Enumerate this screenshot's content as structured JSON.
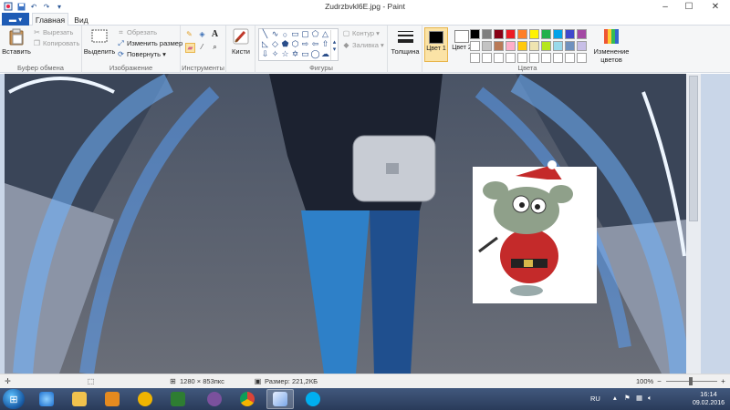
{
  "window": {
    "title": "Zudrzbvkl6E.jpg - Paint",
    "controls": {
      "minimize": "–",
      "maximize": "☐",
      "close": "✕"
    }
  },
  "tabs": {
    "file_label": "▬ ▾",
    "home": "Главная",
    "view": "Вид"
  },
  "ribbon": {
    "clipboard": {
      "paste": "Вставить",
      "cut": "Вырезать",
      "copy": "Копировать",
      "label": "Буфер обмена"
    },
    "image": {
      "select": "Выделить",
      "crop": "Обрезать",
      "resize": "Изменить размер",
      "rotate": "Повернуть ▾",
      "label": "Изображение"
    },
    "tools": {
      "label": "Инструменты"
    },
    "brushes": {
      "label": "Кисти"
    },
    "shapes": {
      "outline": "Контур ▾",
      "fill": "Заливка ▾",
      "label": "Фигуры"
    },
    "thickness": {
      "label": "Толщина"
    },
    "colors": {
      "color1": "Цвет 1",
      "color2": "Цвет 2",
      "edit": "Изменение цветов",
      "label": "Цвета",
      "color1_value": "#000000",
      "color2_value": "#ffffff",
      "palette": [
        "#000000",
        "#7f7f7f",
        "#880015",
        "#ed1c24",
        "#ff7f27",
        "#fff200",
        "#22b14c",
        "#00a2e8",
        "#3f48cc",
        "#a349a4",
        "#ffffff",
        "#c3c3c3",
        "#b97a57",
        "#ffaec9",
        "#ffc90e",
        "#efe4b0",
        "#b5e61d",
        "#99d9ea",
        "#7092be",
        "#c8bfe7",
        "#ffffff",
        "#ffffff",
        "#ffffff",
        "#ffffff",
        "#ffffff",
        "#ffffff",
        "#ffffff",
        "#ffffff",
        "#ffffff",
        "#ffffff"
      ]
    }
  },
  "status": {
    "dimensions": "1280 × 853пкс",
    "size": "Размер: 221,2КБ",
    "zoom": "100%"
  },
  "taskbar": {
    "lang": "RU",
    "time": "16:14",
    "date": "09.02.2016"
  }
}
